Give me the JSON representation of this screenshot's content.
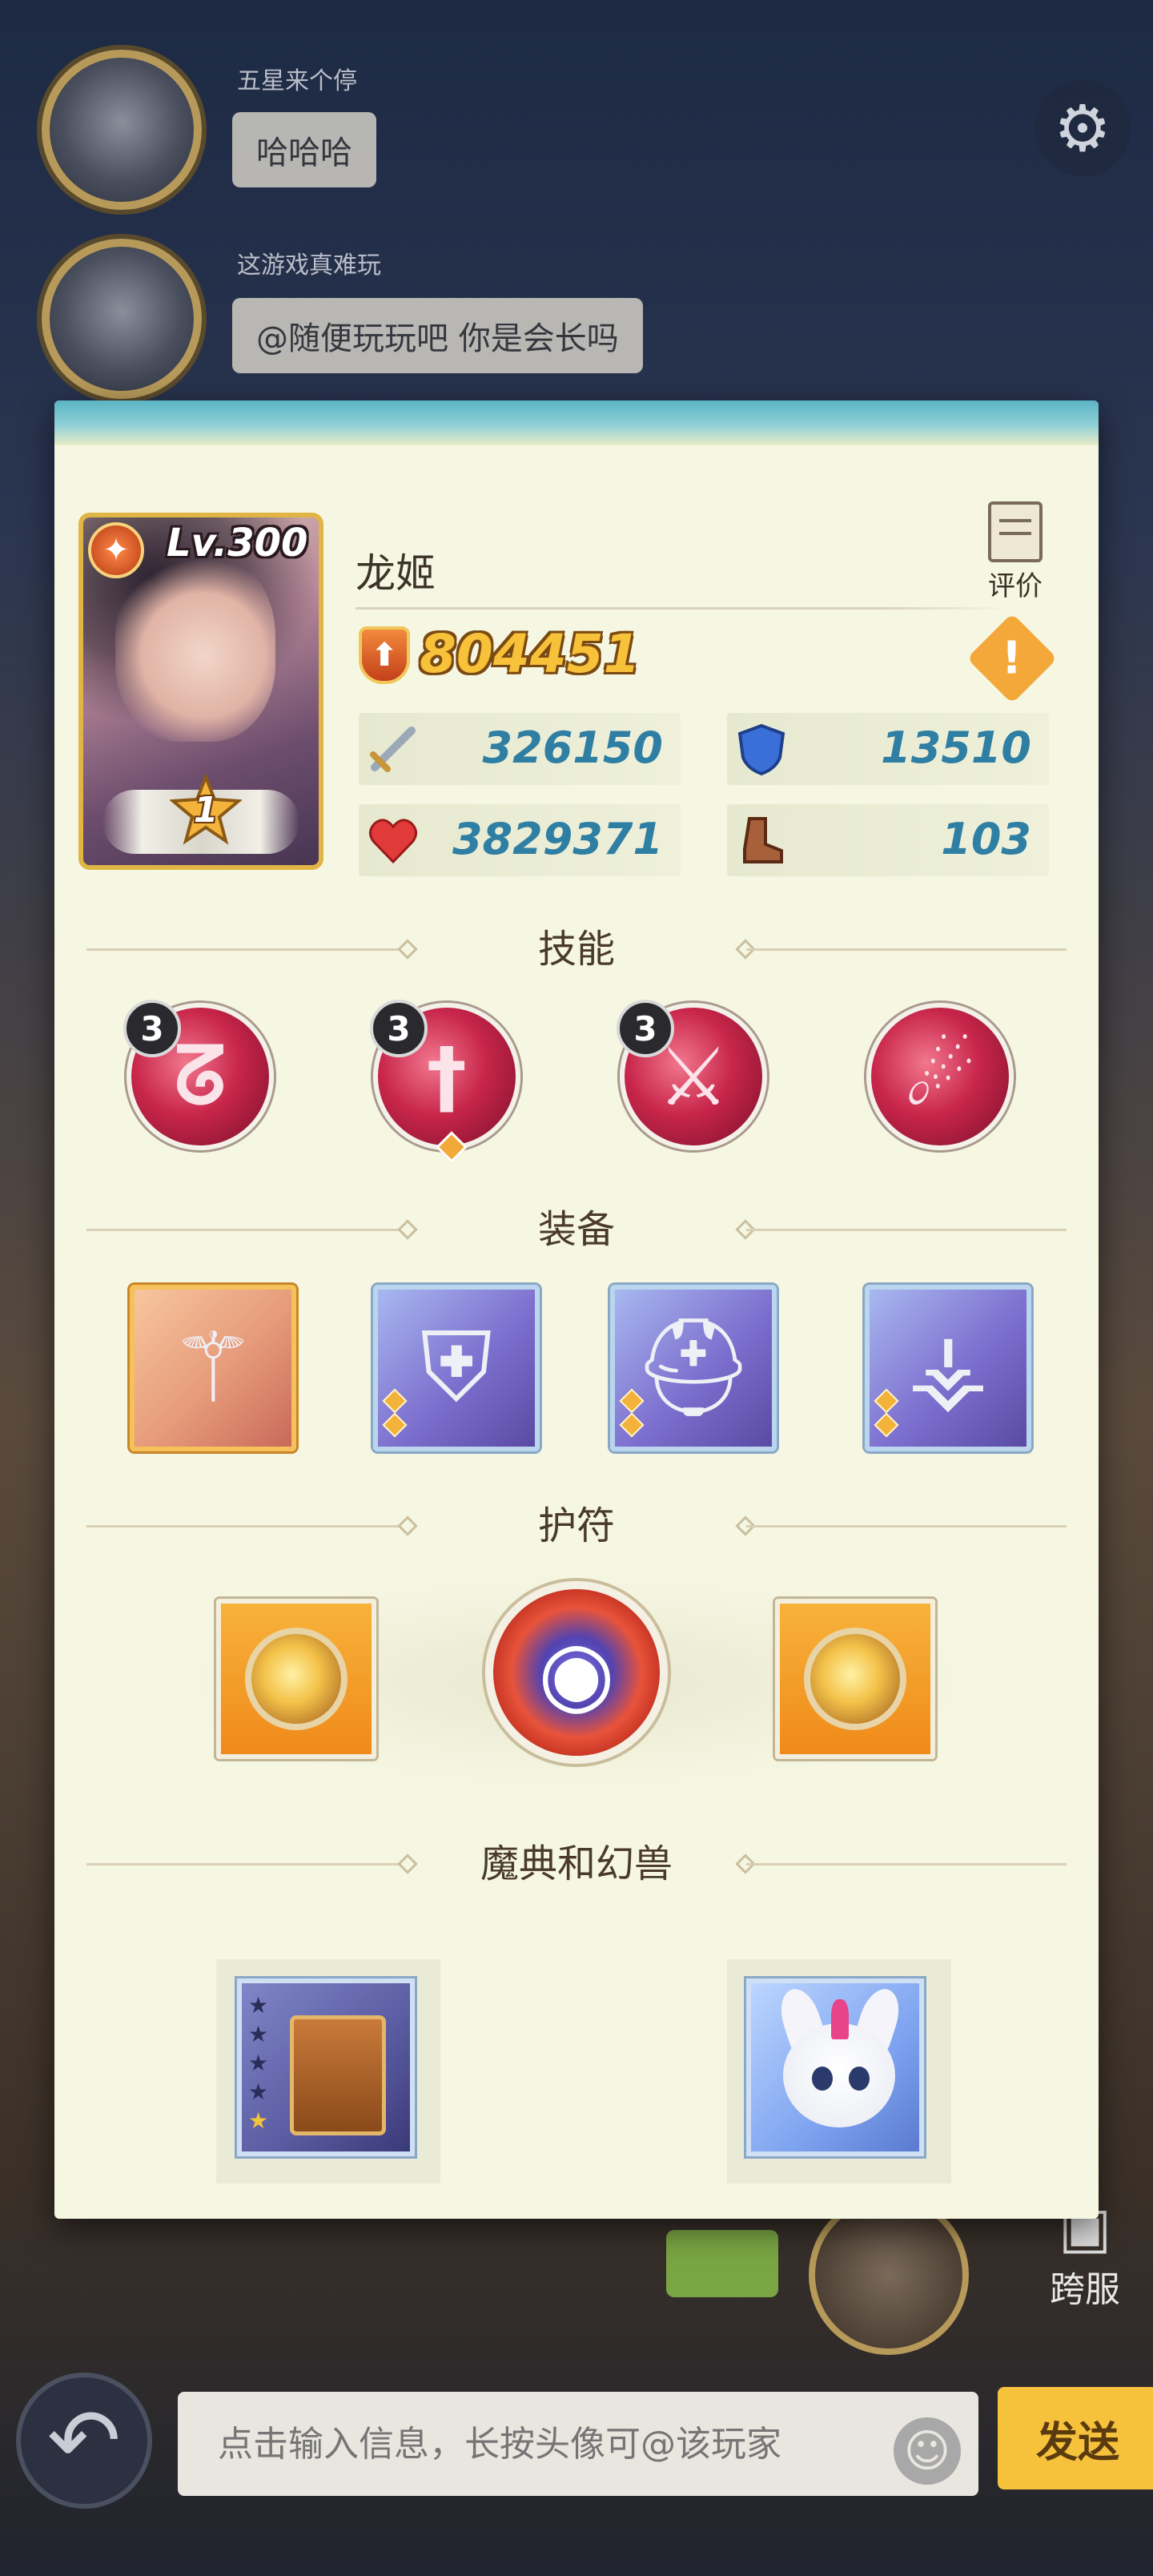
{
  "chat": {
    "messages": [
      {
        "sender": "五星来个停",
        "text": "哈哈哈"
      },
      {
        "sender": "这游戏真难玩",
        "text": "@随便玩玩吧 你是会长吗"
      }
    ]
  },
  "side_buttons": {
    "cross_server": "跨服"
  },
  "input": {
    "placeholder": "点击输入信息，长按头像可@该玩家",
    "send_label": "发送"
  },
  "icons": {
    "settings": "gear-icon",
    "back": "back-arrow-icon",
    "emoji": "emoji-icon",
    "report": "warning-icon",
    "rate": "edit-note-icon",
    "attack": "sword-icon",
    "defense": "shield-icon",
    "hp": "heart-icon",
    "speed": "boot-icon"
  },
  "hero": {
    "name": "龙姬",
    "level_text": "Lv.300",
    "star": "1",
    "power": "804451",
    "rate_label": "评价",
    "stats": {
      "attack": "326150",
      "defense": "13510",
      "hp": "3829371",
      "speed": "103"
    }
  },
  "sections": {
    "skills": "技能",
    "equipment": "装备",
    "amulets": "护符",
    "grimoire_pet": "魔典和幻兽"
  },
  "skills": [
    {
      "level": "3",
      "has_gem": false
    },
    {
      "level": "3",
      "has_gem": true
    },
    {
      "level": "3",
      "has_gem": false
    },
    {
      "level": "",
      "has_gem": false
    }
  ],
  "grimoire": {
    "stars_lit": 1,
    "stars_total": 5
  },
  "colors": {
    "panel_bg": "#f6f7e3",
    "stat_value": "#2f7ea3",
    "power_gold": "#f7c13a",
    "skill_red": "#c8264a",
    "send_button": "#f6c13b"
  }
}
